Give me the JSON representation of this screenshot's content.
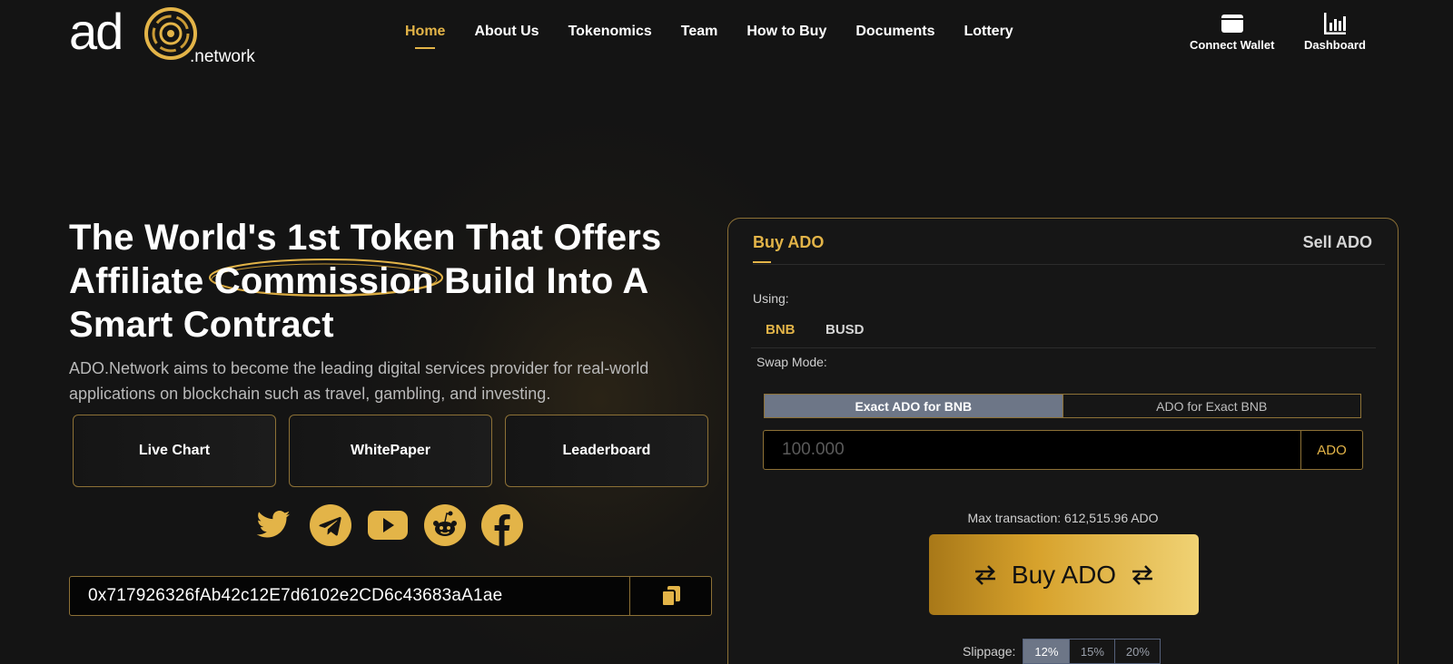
{
  "brand": {
    "logo_text": "ado",
    "logo_suffix": ".network",
    "accent": "#e3b448"
  },
  "nav": {
    "items": [
      {
        "label": "Home",
        "active": true
      },
      {
        "label": "About Us"
      },
      {
        "label": "Tokenomics"
      },
      {
        "label": "Team"
      },
      {
        "label": "How to Buy"
      },
      {
        "label": "Documents"
      },
      {
        "label": "Lottery"
      }
    ]
  },
  "header": {
    "connect_wallet": "Connect Wallet",
    "dashboard": "Dashboard"
  },
  "hero": {
    "title_part1": "The World's 1st Token That Offers Affiliate ",
    "title_highlight": "Commission",
    "title_part2": " Build Into A Smart Contract",
    "description": "ADO.Network aims to become the leading digital services provider for real-world applications on blockchain such as travel, gambling, and investing.",
    "buttons": [
      "Live Chart",
      "WhitePaper",
      "Leaderboard"
    ],
    "socials": [
      "twitter-icon",
      "telegram-icon",
      "youtube-icon",
      "reddit-icon",
      "facebook-icon"
    ],
    "contract_address": "0x717926326fAb42c12E7d6102e2CD6c43683aA1ae"
  },
  "swap": {
    "tab_buy": "Buy ADO",
    "tab_sell": "Sell ADO",
    "using_label": "Using:",
    "currencies": [
      {
        "label": "BNB",
        "selected": true
      },
      {
        "label": "BUSD",
        "selected": false
      }
    ],
    "swap_mode_label": "Swap Mode:",
    "modes": [
      {
        "label": "Exact ADO for BNB",
        "selected": true
      },
      {
        "label": "ADO for Exact BNB",
        "selected": false
      }
    ],
    "amount_placeholder": "100.000",
    "amount_unit": "ADO",
    "max_transaction": "Max transaction: 612,515.96 ADO",
    "buy_button": "Buy ADO",
    "slippage_label": "Slippage:",
    "slippage_options": [
      {
        "label": "12%",
        "selected": true
      },
      {
        "label": "15%"
      },
      {
        "label": "20%"
      }
    ]
  }
}
